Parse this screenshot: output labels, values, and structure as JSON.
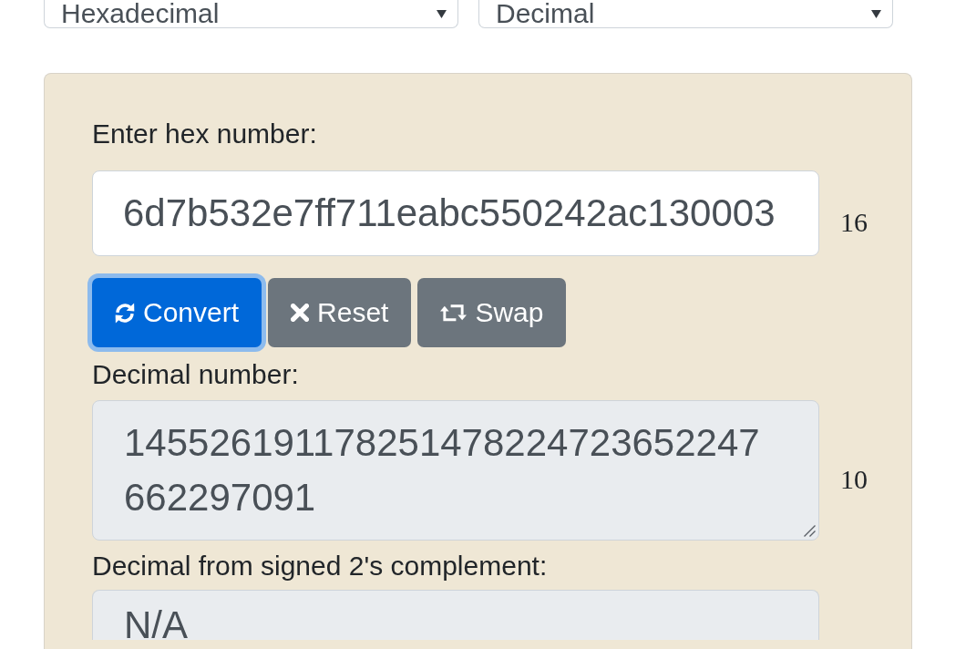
{
  "selects": [
    {
      "value": "Hexadecimal"
    },
    {
      "value": "Decimal"
    }
  ],
  "form": {
    "input": {
      "label": "Enter hex number:",
      "value": "6d7b532e7ff711eabc550242ac130003",
      "base": "16"
    },
    "buttons": [
      {
        "label": "Convert",
        "kind": "convert",
        "focused": true
      },
      {
        "label": "Reset",
        "kind": "reset",
        "focused": false
      },
      {
        "label": "Swap",
        "kind": "swap",
        "focused": false
      }
    ],
    "outputs": [
      {
        "label": "Decimal number:",
        "value": "145526191178251478224723652247662297091",
        "base": "10"
      },
      {
        "label": "Decimal from signed 2's complement:",
        "value": "N/A"
      }
    ]
  }
}
